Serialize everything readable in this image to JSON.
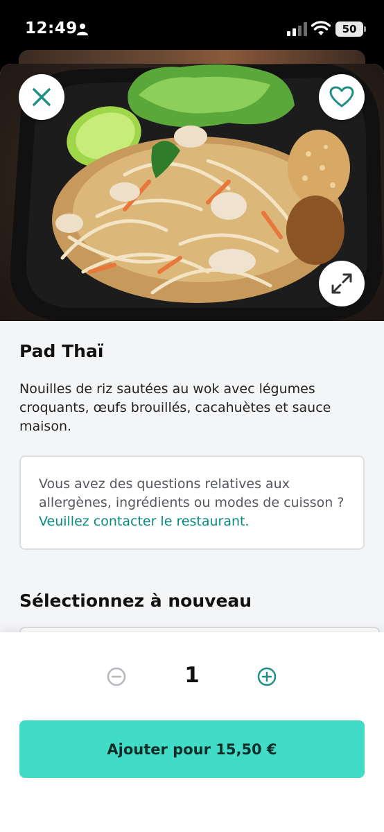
{
  "status_bar": {
    "time": "12:49",
    "battery": "50"
  },
  "item": {
    "title": "Pad Thaï",
    "description": "Nouilles de riz sautées au wok avec légumes croquants, œufs brouillés, cacahuètes et sauce maison."
  },
  "allergen_notice": {
    "text": "Vous avez des questions relatives aux allergènes, ingrédients ou modes de cuisson ?",
    "link": "Veuillez contacter le restaurant."
  },
  "options": {
    "section_title": "Sélectionnez à nouveau"
  },
  "order": {
    "quantity": "1",
    "add_button": "Ajouter pour 15,50 €"
  },
  "colors": {
    "accent": "#41dcc5",
    "link": "#0a8a80",
    "icon": "#1f8f86"
  },
  "icons": {
    "close": "close-icon",
    "favorite": "heart-icon",
    "expand": "expand-icon",
    "minus": "minus-circle-icon",
    "plus": "plus-circle-icon"
  }
}
